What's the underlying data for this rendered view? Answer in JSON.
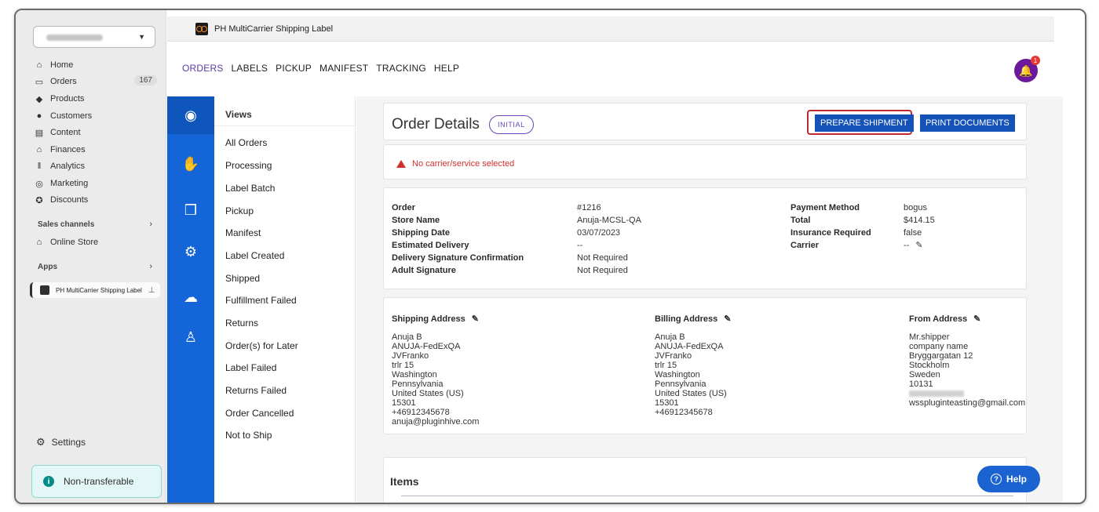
{
  "shopify_nav": {
    "store_name_blurred": "Anuja-MCSL-QA",
    "items": [
      {
        "label": "Home",
        "icon": "home-icon"
      },
      {
        "label": "Orders",
        "icon": "orders-icon",
        "badge": "167"
      },
      {
        "label": "Products",
        "icon": "tag-icon"
      },
      {
        "label": "Customers",
        "icon": "person-icon"
      },
      {
        "label": "Content",
        "icon": "content-icon"
      },
      {
        "label": "Finances",
        "icon": "bank-icon"
      },
      {
        "label": "Analytics",
        "icon": "bar-chart-icon"
      },
      {
        "label": "Marketing",
        "icon": "target-icon"
      },
      {
        "label": "Discounts",
        "icon": "discount-icon"
      }
    ],
    "sales_channels_label": "Sales channels",
    "online_store_label": "Online Store",
    "apps_label": "Apps",
    "app_item_label": "PH MultiCarrier Shipping Label",
    "settings_label": "Settings",
    "non_transferable_label": "Non-transferable"
  },
  "app_title": "PH MultiCarrier Shipping Label",
  "top_menu": [
    "ORDERS",
    "LABELS",
    "PICKUP",
    "MANIFEST",
    "TRACKING",
    "HELP"
  ],
  "notification_count": "1",
  "views": {
    "title": "Views",
    "items": [
      "All Orders",
      "Processing",
      "Label Batch",
      "Pickup",
      "Manifest",
      "Label Created",
      "Shipped",
      "Fulfillment Failed",
      "Returns",
      "Order(s) for Later",
      "Label Failed",
      "Returns Failed",
      "Order Cancelled",
      "Not to Ship"
    ]
  },
  "order_details": {
    "title": "Order Details",
    "status": "INITIAL",
    "prepare_label": "PREPARE SHIPMENT",
    "print_label": "PRINT DOCUMENTS",
    "warning": "No carrier/service selected"
  },
  "order_info": {
    "left_labels": [
      "Order",
      "Store Name",
      "Shipping Date",
      "Estimated Delivery",
      "Delivery Signature Confirmation",
      "Adult Signature"
    ],
    "left_values": [
      "#1216",
      "Anuja-MCSL-QA",
      "03/07/2023",
      "--",
      "Not Required",
      "Not Required"
    ],
    "right_labels": [
      "Payment Method",
      "Total",
      "Insurance Required",
      "Carrier"
    ],
    "right_values": [
      "bogus",
      "$414.15",
      "false",
      "--"
    ]
  },
  "addresses": {
    "shipping_title": "Shipping Address",
    "shipping_lines": [
      "Anuja B",
      "ANUJA-FedExQA",
      "JVFranko",
      "trlr 15",
      "Washington",
      "Pennsylvania",
      "United States (US)",
      "15301",
      "+46912345678",
      "anuja@pluginhive.com"
    ],
    "billing_title": "Billing Address",
    "billing_lines": [
      "Anuja B",
      "ANUJA-FedExQA",
      "JVFranko",
      "trlr 15",
      "Washington",
      "Pennsylvania",
      "United States (US)",
      "15301",
      "+46912345678"
    ],
    "from_title": "From Address",
    "from_lines": [
      "Mr.shipper",
      "company name",
      "Bryggargatan 12",
      "Stockholm",
      "Sweden",
      "10131"
    ],
    "from_phone_blurred": "09876543210",
    "from_email": "wsspluginteasting@gmail.com"
  },
  "items_title": "Items",
  "help_label": "Help",
  "colors": {
    "accent": "#1466d8",
    "primary_button": "#1552b8",
    "warning": "#d32f2f",
    "active_menu": "#5c3aa6",
    "bell": "#6a1a9a"
  }
}
